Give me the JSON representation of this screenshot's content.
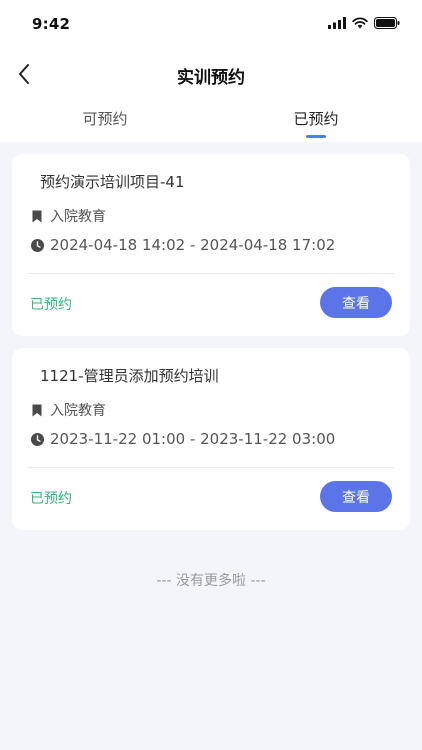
{
  "status_bar": {
    "time": "9:42"
  },
  "header": {
    "title": "实训预约"
  },
  "tabs": [
    {
      "label": "可预约",
      "active": false
    },
    {
      "label": "已预约",
      "active": true
    }
  ],
  "reservations": [
    {
      "title": "预约演示培训项目-41",
      "category": "入院教育",
      "time_range": "2024-04-18 14:02 - 2024-04-18 17:02",
      "status": "已预约",
      "action_label": "查看"
    },
    {
      "title": "1121-管理员添加预约培训",
      "category": "入院教育",
      "time_range": "2023-11-22 01:00 - 2023-11-22 03:00",
      "status": "已预约",
      "action_label": "查看"
    }
  ],
  "footer": {
    "no_more_text": "--- 没有更多啦 ---"
  },
  "colors": {
    "accent": "#5b75e8",
    "status_green": "#38b27c",
    "tab_indicator": "#4a7ff5",
    "background": "#f4f5f9"
  },
  "icons": {
    "back": "chevron-left-icon",
    "category": "bookmark-icon",
    "time": "clock-icon",
    "signal": "signal-icon",
    "wifi": "wifi-icon",
    "battery": "battery-icon"
  }
}
